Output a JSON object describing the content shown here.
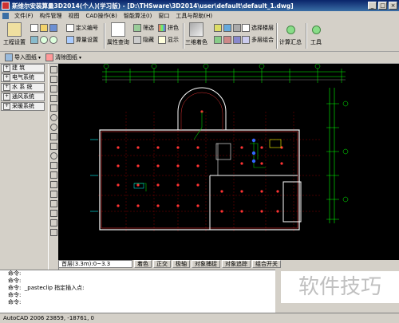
{
  "title": "斯维尔安装算量3D2014(个人)(学习版) - [D:\\THSware\\3D2014\\user\\default\\default_1.dwg]",
  "menu": [
    "文件(F)",
    "构件管理",
    "视图",
    "CAD操作(B)",
    "智能算法(I)",
    "窗口",
    "工具与帮助(H)"
  ],
  "toolbar": {
    "project_settings": "工程设置",
    "define_code": "定义编号",
    "calc_settings": "算量设置",
    "attr_query": "属性查询",
    "filter": "筛选",
    "hide": "隐藏",
    "color": "拼色",
    "show": "显示",
    "three_d_color": "三维着色",
    "select_layer": "选择楼层",
    "multi_layer": "多层组合",
    "calc_summary": "计算汇总",
    "tools": "工具"
  },
  "toolbar2": {
    "import_drawing": "导入图纸",
    "clear_drawing": "清除图纸"
  },
  "sidebar": {
    "items": [
      {
        "label": "建    筑"
      },
      {
        "label": "电气系统"
      },
      {
        "label": "水 系 统"
      },
      {
        "label": "通风系统"
      },
      {
        "label": "采暖系统"
      }
    ]
  },
  "layer_status": {
    "current_layer": "首层(3.3m):0~3.3",
    "buttons": [
      "着色",
      "正交",
      "极轴",
      "对象捕捉",
      "对象追踪",
      "组合开关"
    ]
  },
  "command": {
    "lines": [
      "命令:",
      "命令:",
      "命令:  _pasteclip 指定插入点:",
      "命令:",
      "命令:"
    ]
  },
  "watermark": "软件技巧",
  "statusbar": "AutoCAD 2006  23859, -18761, 0"
}
